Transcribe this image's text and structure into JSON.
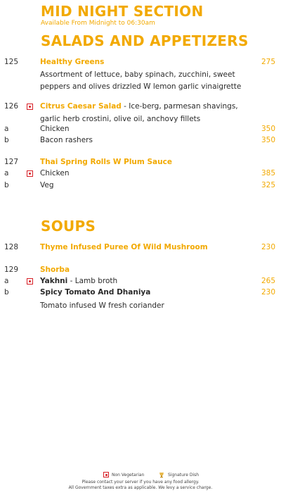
{
  "header": {
    "title": "MID NIGHT SECTION",
    "subtitle": "Available From Midnight to 06:30am"
  },
  "sections": {
    "salads": {
      "heading": "SALADS AND APPETIZERS",
      "items": [
        {
          "number": "125",
          "name": "Healthy Greens",
          "price": "275",
          "desc_line1": "Assortment of lettuce, baby spinach, zucchini, sweet",
          "desc_line2": "peppers and olives drizzled W lemon garlic vinaigrette"
        },
        {
          "number": "126",
          "name": "Citrus Caesar Salad",
          "inline_desc": " - Ice-berg, parmesan shavings,",
          "desc_line2": "garlic herb crostini, olive oil, anchovy fillets",
          "options": [
            {
              "letter": "a",
              "label": "Chicken",
              "price": "350"
            },
            {
              "letter": "b",
              "label": "Bacon rashers",
              "price": "350"
            }
          ]
        },
        {
          "number": "127",
          "name": "Thai Spring Rolls W Plum Sauce",
          "options": [
            {
              "letter": "a",
              "label": "Chicken",
              "price": "385"
            },
            {
              "letter": "b",
              "label": "Veg",
              "price": "325"
            }
          ]
        }
      ]
    },
    "soups": {
      "heading": "SOUPS",
      "items": [
        {
          "number": "128",
          "name": "Thyme Infused Puree Of Wild Mushroom",
          "price": "230"
        },
        {
          "number": "129",
          "name": "Shorba",
          "options": [
            {
              "letter": "a",
              "label": "Yakhni",
              "suffix": " - Lamb broth",
              "price": "265"
            },
            {
              "letter": "b",
              "label": "Spicy Tomato And Dhaniya",
              "price": "230",
              "desc": "Tomato infused W fresh coriander"
            }
          ]
        }
      ]
    }
  },
  "footer": {
    "legend_non_veg": "Non Vegetarian",
    "legend_signature": "Signature Dish",
    "note1": "Please contact your server if you have any food allergy.",
    "note2": "All Government taxes extra as applicable. We levy a service charge."
  },
  "colors": {
    "accent": "#f2a900",
    "non_veg": "#d71f26",
    "text": "#2a2a2a"
  },
  "icons": {
    "non_veg": "non-veg-icon",
    "signature": "signature-dish-icon"
  }
}
